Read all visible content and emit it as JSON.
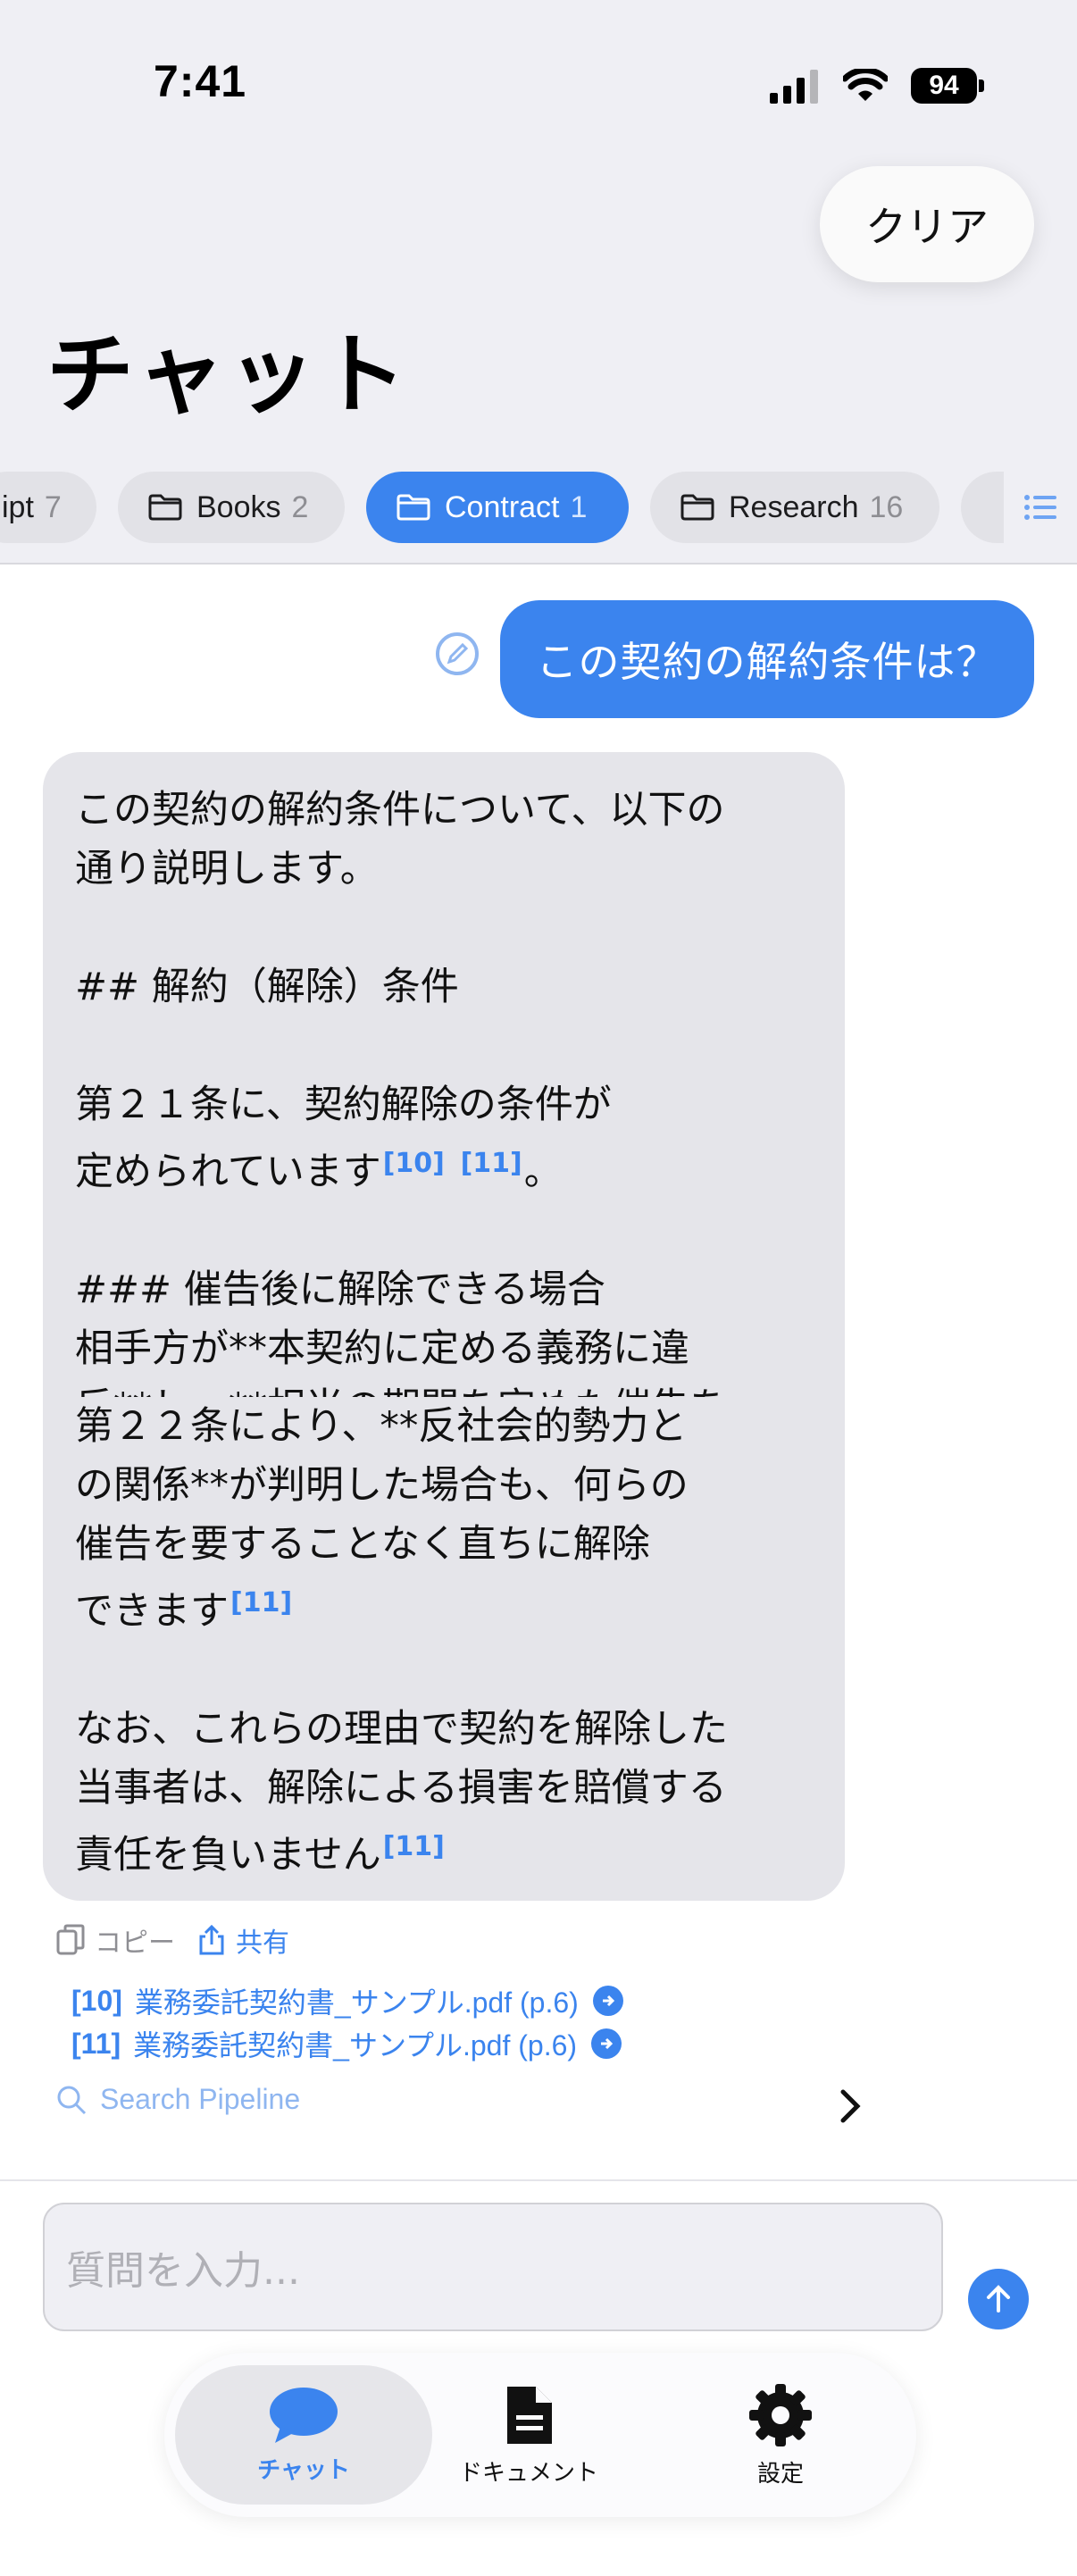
{
  "status_bar": {
    "time": "7:41",
    "battery": "94"
  },
  "header": {
    "clear_label": "クリア",
    "title": "チャット"
  },
  "folders": [
    {
      "name": "ipt",
      "count": "7"
    },
    {
      "name": "Books",
      "count": "2"
    },
    {
      "name": "Contract",
      "count": "1"
    },
    {
      "name": "Research",
      "count": "16"
    }
  ],
  "chat": {
    "user_message": "この契約の解約条件は？",
    "bot_part1_lines": {
      "l1": "この契約の解約条件について、以下の\n通り説明します。\n\n## 解約（解除）条件\n\n第２１条に、契約解除の条件が\n定められています",
      "c1": "[10]",
      "c2": "[11]",
      "l2": "。\n\n### 催告後に解除できる場合\n相手方が**本契約に定める義務に違\n反**し、**相当の期間を定めた催告を"
    },
    "bot_part2": {
      "p1": "第２２条により、**反社会的勢力と\nの関係**が判明した場合も、何らの\n催告を要することなく直ちに解除\nできます",
      "c1": "[11]",
      "p2": "\n\nなお、これらの理由で契約を解除した\n当事者は、解除による損害を賠償する\n責任を負いません",
      "c2": "[11]"
    },
    "actions": {
      "copy": "コピー",
      "share": "共有"
    },
    "sources": [
      {
        "num": "[10]",
        "label": "業務委託契約書_サンプル.pdf (p.6)"
      },
      {
        "num": "[11]",
        "label": "業務委託契約書_サンプル.pdf (p.6)"
      }
    ],
    "pipeline_label": "Search Pipeline"
  },
  "composer": {
    "placeholder": "質問を入力..."
  },
  "tabs": {
    "chat": "チャット",
    "documents": "ドキュメント",
    "settings": "設定"
  },
  "colors": {
    "accent": "#3b84ee",
    "bubble_bot": "#e5e5ea",
    "background_top": "#efeff4"
  }
}
